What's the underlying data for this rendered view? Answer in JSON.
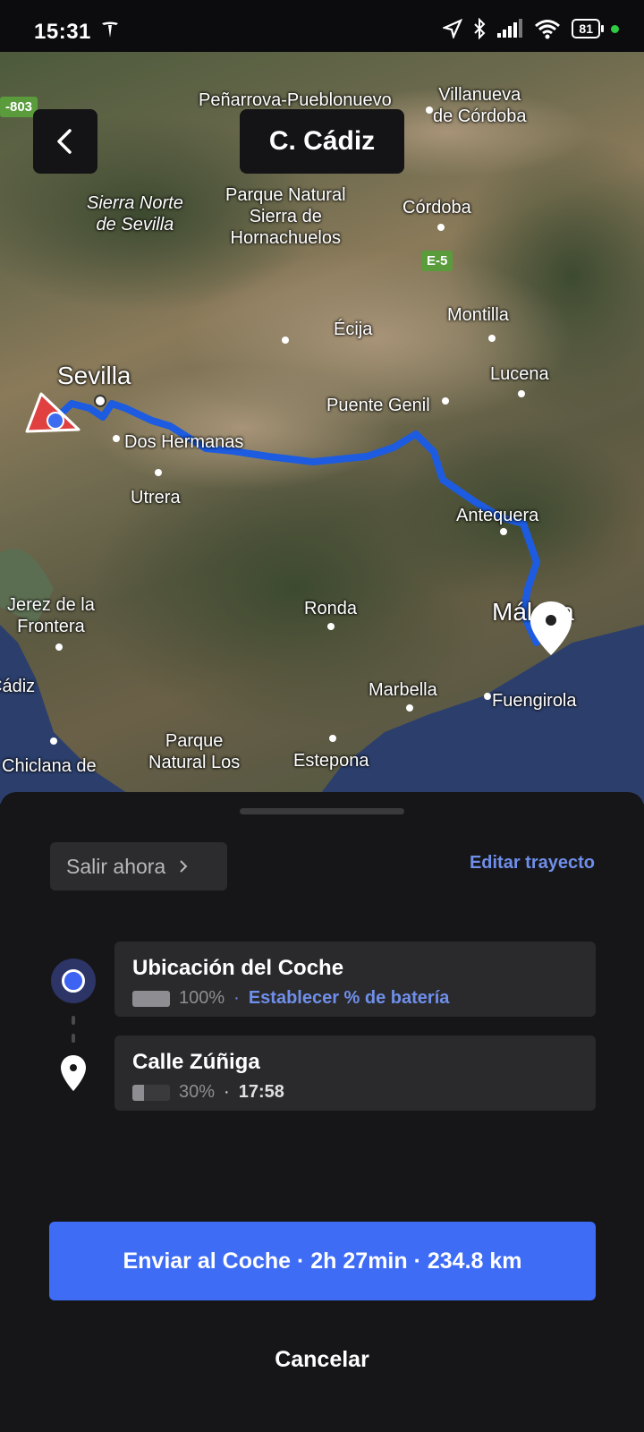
{
  "status_bar": {
    "time": "15:31",
    "battery": "81"
  },
  "map": {
    "title": "C. Cádiz",
    "labels": {
      "penarroya": "Peñarrova-Pueblonuevo",
      "villanueva": "Villanueva\nde Córdoba",
      "sierra_norte": "Sierra Norte\nde Sevilla",
      "hornachuelos": "Parque Natural\nSierra de\nHornachuelos",
      "cordoba": "Córdoba",
      "montilla": "Montilla",
      "ecija": "Écija",
      "sevilla": "Sevilla",
      "lucena": "Lucena",
      "puente_genil": "Puente Genil",
      "dos_hermanas": "Dos Hermanas",
      "utrera": "Utrera",
      "antequera": "Antequera",
      "jerez": "Jerez de la\nFrontera",
      "ronda": "Ronda",
      "malaga": "Málaga",
      "cadiz": "Cádiz",
      "marbella": "Marbella",
      "fuengirola": "Fuengirola",
      "parque_los": "Parque\nNatural Los",
      "chiclana": "Chiclana de",
      "estepona": "Estepona"
    },
    "shields": {
      "a803": "-803",
      "e5": "E-5"
    }
  },
  "sheet": {
    "leave_now": "Salir ahora",
    "edit_route": "Editar trayecto",
    "stops": [
      {
        "name": "Ubicación del Coche",
        "battery": "100%",
        "battery_level": 1.0,
        "extra": "Establecer % de batería"
      },
      {
        "name": "Calle Zúñiga",
        "battery": "30%",
        "battery_level": 0.3,
        "extra": "17:58"
      }
    ],
    "separator": "·",
    "send_button": "Enviar al Coche · 2h 27min · 234.8 km",
    "cancel": "Cancelar"
  }
}
